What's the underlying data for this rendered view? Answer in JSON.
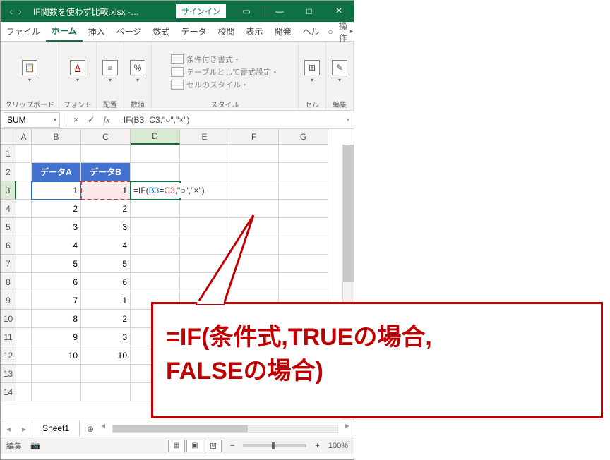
{
  "titlebar": {
    "title": "IF関数を使わず比較.xlsx -…",
    "signin": "サインイン"
  },
  "ribbon": {
    "tabs": [
      "ファイル",
      "ホーム",
      "挿入",
      "ページ",
      "数式",
      "データ",
      "校閲",
      "表示",
      "開発",
      "ヘル"
    ],
    "active_index": 1,
    "right_help": "○",
    "right_op": "操作"
  },
  "groups": {
    "clipboard": {
      "label": "クリップボード",
      "btn": "貼"
    },
    "font": {
      "label": "フォント",
      "icon": "A"
    },
    "align": {
      "label": "配置",
      "icon": "≡"
    },
    "number": {
      "label": "数値",
      "icon": "%"
    },
    "styles": {
      "label": "スタイル",
      "items": [
        "条件付き書式・",
        "テーブルとして書式設定・",
        "セルのスタイル・"
      ]
    },
    "cells": {
      "label": "セル",
      "icon": "⊞"
    },
    "edit": {
      "label": "編集",
      "icon": "✎"
    }
  },
  "formula_bar": {
    "name_box": "SUM",
    "formula": "=IF(B3=C3,\"○\",\"×\")"
  },
  "sheet": {
    "cols": [
      "A",
      "B",
      "C",
      "D",
      "E",
      "F",
      "G"
    ],
    "rows": [
      "1",
      "2",
      "3",
      "4",
      "5",
      "6",
      "7",
      "8",
      "9",
      "10",
      "11",
      "12",
      "13",
      "14"
    ],
    "headers": {
      "B2": "データA",
      "C2": "データB"
    },
    "data_B": [
      "1",
      "2",
      "3",
      "4",
      "5",
      "6",
      "7",
      "8",
      "9",
      "10"
    ],
    "data_C": [
      "1",
      "2",
      "3",
      "4",
      "5",
      "6",
      "1",
      "2",
      "3",
      "10"
    ],
    "d3_display": {
      "prefix": "=IF(",
      "ref1": "B3",
      "eq": "=",
      "ref2": "C3",
      "suffix": ",\"○\",\"×\")"
    }
  },
  "tabs": {
    "sheet1": "Sheet1",
    "add": "⊕"
  },
  "status": {
    "mode": "編集",
    "rec": "📷",
    "zoom": "100%"
  },
  "callout": {
    "line1": "=IF(条件式,TRUEの場合,",
    "line2": "FALSEの場合)"
  }
}
